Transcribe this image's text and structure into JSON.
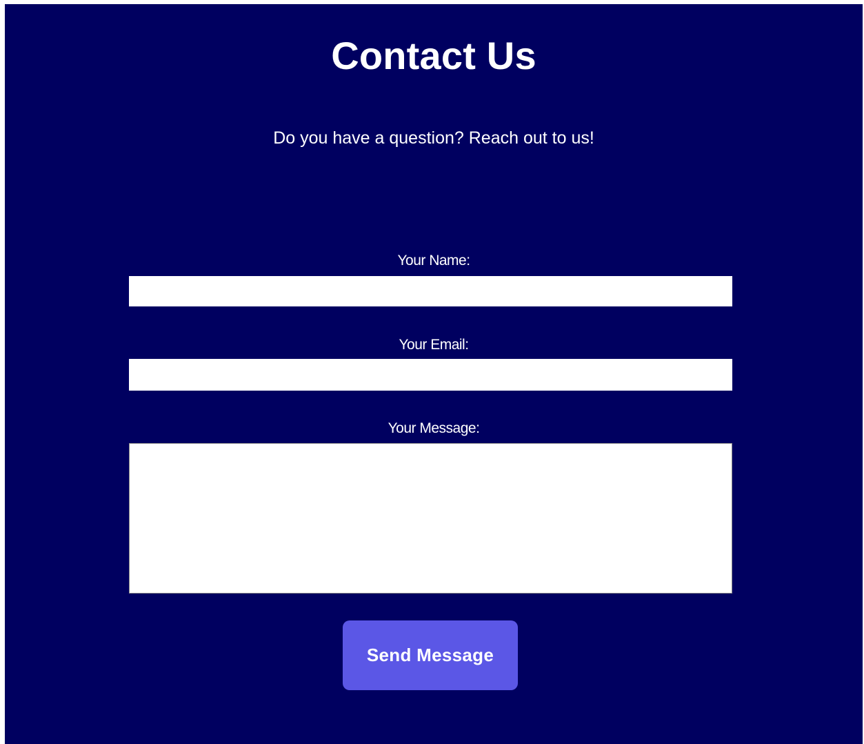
{
  "page": {
    "title": "Contact Us",
    "subtitle": "Do you have a question? Reach out to us!"
  },
  "form": {
    "name_label": "Your Name:",
    "name_value": "",
    "email_label": "Your Email:",
    "email_value": "",
    "message_label": "Your Message:",
    "message_value": "",
    "submit_label": "Send Message"
  },
  "colors": {
    "background": "#000060",
    "button": "#5b57e6",
    "text": "#ffffff"
  }
}
